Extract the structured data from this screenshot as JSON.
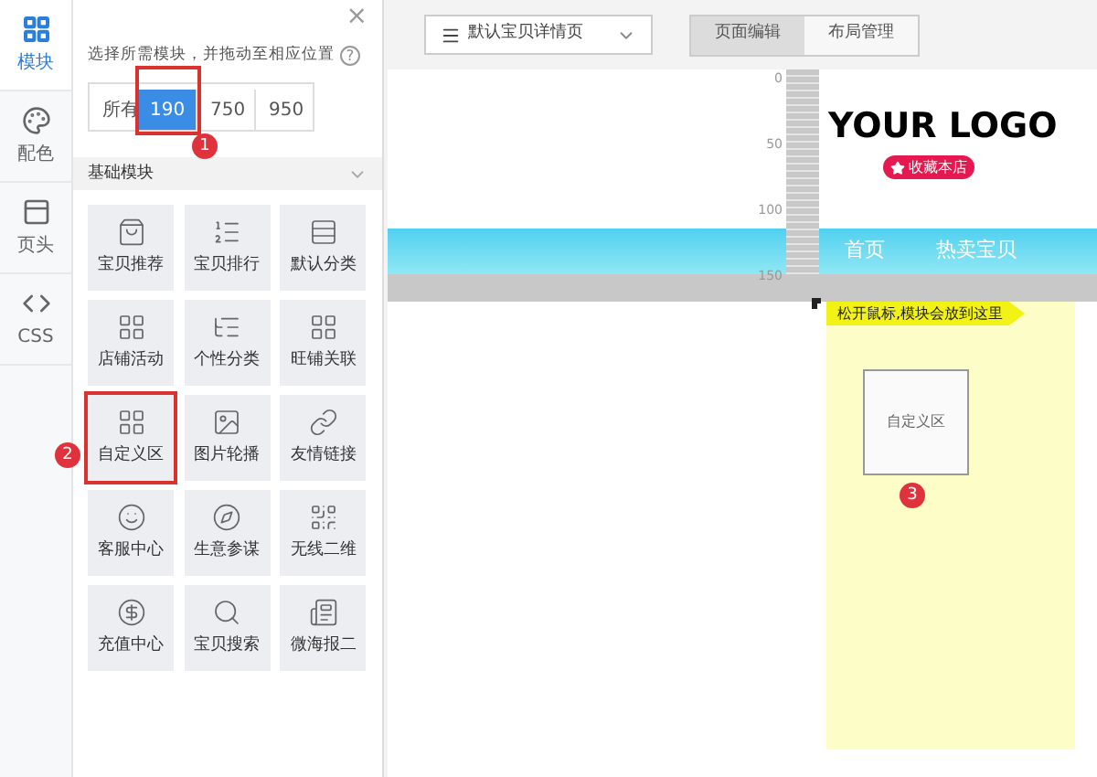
{
  "rail": [
    {
      "label": "模块",
      "kind": "modules",
      "selected": true
    },
    {
      "label": "配色",
      "kind": "palette",
      "selected": false
    },
    {
      "label": "页头",
      "kind": "header",
      "selected": false
    },
    {
      "label": "CSS",
      "kind": "code",
      "selected": false
    }
  ],
  "panel": {
    "close": "×",
    "hint": "选择所需模块，并拖动至相应位置",
    "help": "?",
    "filters": [
      {
        "label": "所有",
        "selected": false,
        "highlighted": false
      },
      {
        "label": "190",
        "selected": true,
        "highlighted": true
      },
      {
        "label": "750",
        "selected": false,
        "highlighted": false
      },
      {
        "label": "950",
        "selected": false,
        "highlighted": false
      }
    ],
    "filter_badge": "1",
    "section": "基础模块",
    "modules": [
      {
        "label": "宝贝推荐",
        "kind": "bag",
        "highlighted": false
      },
      {
        "label": "宝贝排行",
        "kind": "rank",
        "highlighted": false
      },
      {
        "label": "默认分类",
        "kind": "category",
        "highlighted": false
      },
      {
        "label": "店铺活动",
        "kind": "grid",
        "highlighted": false
      },
      {
        "label": "个性分类",
        "kind": "tree",
        "highlighted": false
      },
      {
        "label": "旺铺关联",
        "kind": "grid",
        "highlighted": false
      },
      {
        "label": "自定义区",
        "kind": "grid",
        "highlighted": true
      },
      {
        "label": "图片轮播",
        "kind": "image",
        "highlighted": false
      },
      {
        "label": "友情链接",
        "kind": "link",
        "highlighted": false
      },
      {
        "label": "客服中心",
        "kind": "service",
        "highlighted": false
      },
      {
        "label": "生意参谋",
        "kind": "compass",
        "highlighted": false
      },
      {
        "label": "无线二维",
        "kind": "qr",
        "highlighted": false
      },
      {
        "label": "充值中心",
        "kind": "dollar",
        "highlighted": false
      },
      {
        "label": "宝贝搜索",
        "kind": "search",
        "highlighted": false
      },
      {
        "label": "微海报二",
        "kind": "poster",
        "highlighted": false
      }
    ],
    "module_badge": "2"
  },
  "toolbar": {
    "page_select": "默认宝贝详情页",
    "tabs": [
      {
        "label": "页面编辑",
        "selected": true
      },
      {
        "label": "布局管理",
        "selected": false
      }
    ]
  },
  "canvas": {
    "ruler": [
      "0",
      "50",
      "100",
      "150"
    ],
    "logo": "YOUR LOGO",
    "favorite": "收藏本店",
    "nav": [
      "首页",
      "热卖宝贝"
    ],
    "drop_hint": "松开鼠标,模块会放到这里",
    "dropped_module": "自定义区",
    "drop_badge": "3"
  }
}
